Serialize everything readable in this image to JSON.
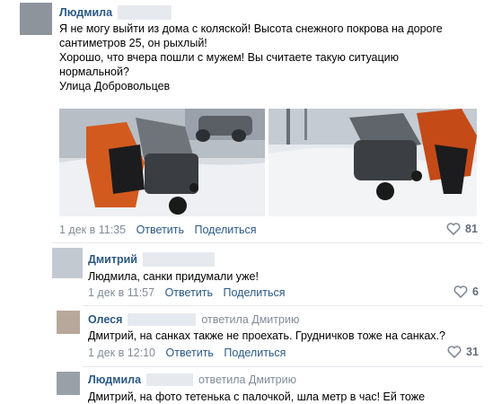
{
  "comments": [
    {
      "author": "Людмила",
      "lines": [
        "Я не могу выйти из дома с коляской! Высота снежного покрова на дороге",
        "сантиметров 25, он рыхлый!",
        "Хорошо, что вчера пошли с мужем! Вы считаете такую ситуацию",
        "нормальной?",
        "Улица Добровольцев"
      ],
      "date": "1 дек в 11:35",
      "reply": "Ответить",
      "share": "Поделиться",
      "likes": "81"
    },
    {
      "author": "Дмитрий",
      "text": "Людмила, санки придумали уже!",
      "date": "1 дек в 11:57",
      "reply": "Ответить",
      "share": "Поделиться",
      "likes": "6"
    },
    {
      "author": "Олеся",
      "replied_to": "ответила Дмитрию",
      "text": "Дмитрий, на санках также не проехать. Грудничков тоже на санках.?",
      "date": "1 дек в 12:10",
      "reply": "Ответить",
      "share": "Поделиться",
      "likes": "31"
    },
    {
      "author": "Людмила",
      "replied_to": "ответила Дмитрию",
      "text": "Дмитрий, на фото тетенька с палочкой, шла метр в час! Ей тоже"
    }
  ],
  "icons": {
    "like": "heart-icon"
  },
  "colors": {
    "link": "#2a5885",
    "meta": "#818c99",
    "likes": "#626d7a"
  }
}
